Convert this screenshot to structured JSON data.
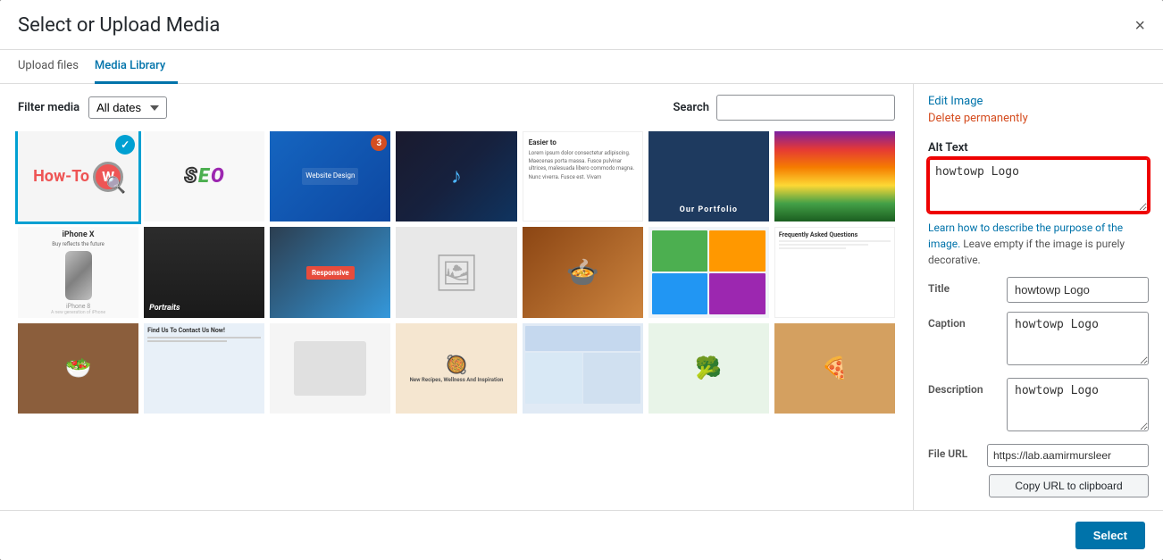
{
  "modal": {
    "title": "Select or Upload Media",
    "close_label": "×"
  },
  "tabs": [
    {
      "id": "upload",
      "label": "Upload files",
      "active": false
    },
    {
      "id": "library",
      "label": "Media Library",
      "active": true
    }
  ],
  "filter": {
    "label": "Filter media",
    "date_options": [
      "All dates"
    ],
    "date_selected": "All dates",
    "search_label": "Search",
    "search_placeholder": ""
  },
  "sidebar": {
    "edit_image_label": "Edit Image",
    "delete_label": "Delete permanently",
    "alt_text_label": "Alt Text",
    "alt_text_value": "howtowp Logo",
    "alt_text_description_link": "Learn how to describe the purpose of the image.",
    "alt_text_description_rest": " Leave empty if the image is purely decorative.",
    "title_label": "Title",
    "title_value": "howtowp Logo",
    "caption_label": "Caption",
    "caption_value": "howtowp Logo",
    "description_label": "Description",
    "description_value": "howtowp Logo",
    "file_url_label": "File URL",
    "file_url_value": "https://lab.aamirmursleer",
    "copy_url_label": "Copy URL to clipboard",
    "select_label": "Select"
  },
  "grid": {
    "items": [
      {
        "id": 1,
        "selected": true,
        "badge": "check",
        "type": "howtowp"
      },
      {
        "id": 2,
        "selected": false,
        "badge": null,
        "type": "seo"
      },
      {
        "id": 3,
        "selected": false,
        "badge": "notification",
        "type": "dark-blue"
      },
      {
        "id": 4,
        "selected": false,
        "badge": null,
        "type": "photo-dark"
      },
      {
        "id": 5,
        "selected": false,
        "badge": null,
        "type": "article"
      },
      {
        "id": 6,
        "selected": false,
        "badge": null,
        "type": "portfolio"
      },
      {
        "id": 7,
        "selected": false,
        "badge": null,
        "type": "rainbow"
      },
      {
        "id": 8,
        "selected": false,
        "badge": null,
        "type": "iphone"
      },
      {
        "id": 9,
        "selected": false,
        "badge": null,
        "type": "woman"
      },
      {
        "id": 10,
        "selected": false,
        "badge": null,
        "type": "responsive"
      },
      {
        "id": 11,
        "selected": false,
        "badge": null,
        "type": "placeholder"
      },
      {
        "id": 12,
        "selected": false,
        "badge": null,
        "type": "food"
      },
      {
        "id": 13,
        "selected": false,
        "badge": null,
        "type": "website-grid"
      },
      {
        "id": 14,
        "selected": false,
        "badge": null,
        "type": "questions"
      },
      {
        "id": 15,
        "selected": false,
        "badge": null,
        "type": "food3"
      },
      {
        "id": 16,
        "selected": false,
        "badge": null,
        "type": "contact"
      },
      {
        "id": 17,
        "selected": false,
        "badge": null,
        "type": "light"
      },
      {
        "id": 18,
        "selected": false,
        "badge": null,
        "type": "market"
      },
      {
        "id": 19,
        "selected": false,
        "badge": null,
        "type": "product"
      },
      {
        "id": 20,
        "selected": false,
        "badge": null,
        "type": "blog"
      },
      {
        "id": 21,
        "selected": false,
        "badge": null,
        "type": "food2"
      }
    ]
  }
}
